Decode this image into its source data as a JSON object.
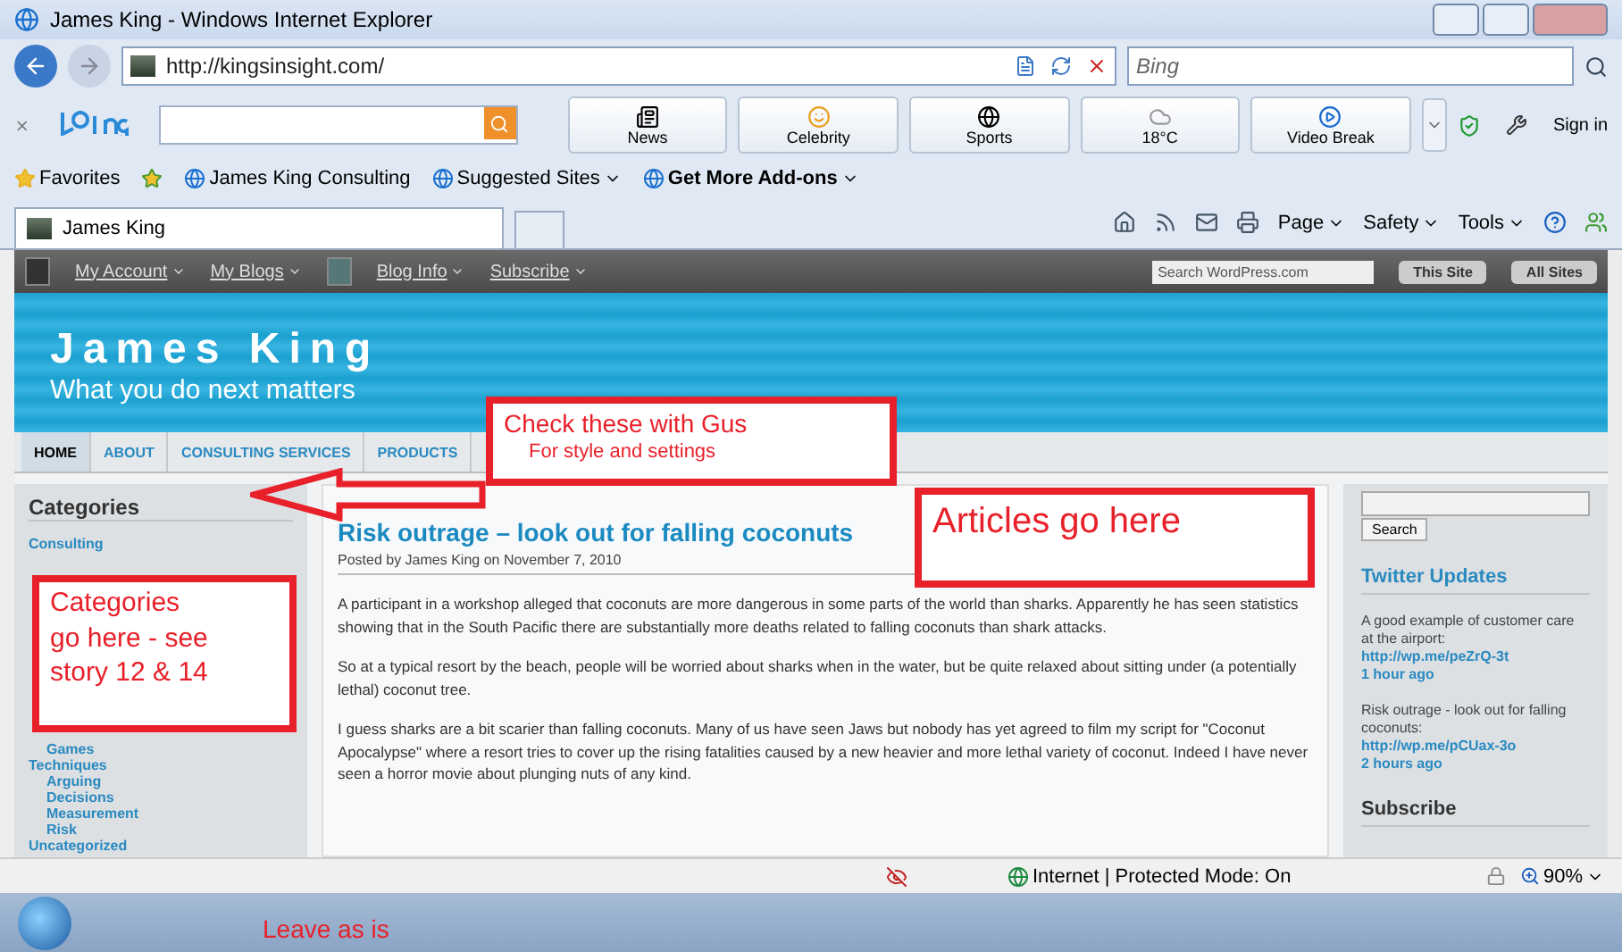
{
  "window": {
    "title": "James King - Windows Internet Explorer"
  },
  "address_bar": {
    "url": "http://kingsinsight.com/",
    "search_placeholder": "Bing"
  },
  "bing_toolbar": {
    "buttons": [
      {
        "label": "News",
        "kind": "news"
      },
      {
        "label": "Celebrity",
        "kind": "celebrity"
      },
      {
        "label": "Sports",
        "kind": "sports"
      },
      {
        "label": "18°C",
        "kind": "weather"
      },
      {
        "label": "Video Break",
        "kind": "video"
      }
    ],
    "sign_in": "Sign in"
  },
  "favorites_bar": {
    "favorites": "Favorites",
    "links": [
      {
        "label": "James King Consulting",
        "dropdown": false,
        "bold": false
      },
      {
        "label": "Suggested Sites",
        "dropdown": true,
        "bold": false
      },
      {
        "label": "Get More Add-ons",
        "dropdown": true,
        "bold": true
      }
    ]
  },
  "tabs": [
    {
      "label": "James King",
      "selected": true
    }
  ],
  "command_bar": {
    "menus": [
      "Page",
      "Safety",
      "Tools"
    ]
  },
  "admin_bar": {
    "menus": [
      "My Account",
      "My Blogs",
      "Blog Info",
      "Subscribe"
    ],
    "search_placeholder": "Search WordPress.com",
    "buttons": [
      "This Site",
      "All Sites"
    ]
  },
  "blog": {
    "title": "James King",
    "tagline": "What you do next matters"
  },
  "nav": [
    {
      "label": "HOME",
      "selected": true
    },
    {
      "label": "ABOUT",
      "selected": false
    },
    {
      "label": "CONSULTING SERVICES",
      "selected": false
    },
    {
      "label": "PRODUCTS",
      "selected": false
    }
  ],
  "sidebar": {
    "heading": "Categories",
    "items": [
      {
        "label": "Consulting",
        "children": [
          {
            "label": "Games"
          }
        ]
      },
      {
        "label": "Techniques",
        "children": [
          {
            "label": "Arguing"
          },
          {
            "label": "Decisions"
          },
          {
            "label": "Measurement"
          },
          {
            "label": "Risk"
          }
        ]
      },
      {
        "label": "Uncategorized"
      }
    ]
  },
  "article": {
    "title": "Risk outrage – look out for falling coconuts",
    "byline": "Posted by James King on November 7, 2010",
    "paragraphs": [
      "A participant in a workshop alleged that coconuts are more dangerous in some parts of the world than sharks. Apparently he has seen statistics showing that in the South Pacific there are substantially more deaths related to falling coconuts than shark attacks.",
      "So at a typical resort by the beach, people will be worried about sharks when in the water, but be quite relaxed about sitting under (a potentially lethal) coconut tree.",
      "I guess sharks are a bit  scarier than falling coconuts. Many of us have seen Jaws but nobody has yet agreed to film my script for \"Coconut Apocalypse\" where a resort tries to cover up the rising fatalities caused by a new heavier and more lethal variety of coconut. Indeed I have never seen a horror movie about plunging nuts of any kind."
    ]
  },
  "right_sidebar": {
    "search_button": "Search",
    "twitter_heading": "Twitter Updates",
    "tweets": [
      {
        "text": "A good example of customer care at the airport:",
        "link": "http://wp.me/peZrQ-3t",
        "time": "1 hour ago"
      },
      {
        "text": "Risk outrage - look out for falling coconuts:",
        "link": "http://wp.me/pCUax-3o",
        "time": "2 hours ago"
      }
    ],
    "subscribe_heading": "Subscribe"
  },
  "status_bar": {
    "zone": "Internet | Protected Mode: On",
    "zoom": "90%"
  },
  "annotations": [
    {
      "kind": "box",
      "lines": [
        "Check these with Gus",
        "For style and settings"
      ]
    },
    {
      "kind": "box",
      "lines": [
        "Articles go here"
      ]
    },
    {
      "kind": "box",
      "lines": [
        "Categories",
        "go here - see",
        "story 12 & 14"
      ]
    },
    {
      "kind": "arrow"
    },
    {
      "kind": "text",
      "lines": [
        "Leave as is"
      ]
    }
  ]
}
